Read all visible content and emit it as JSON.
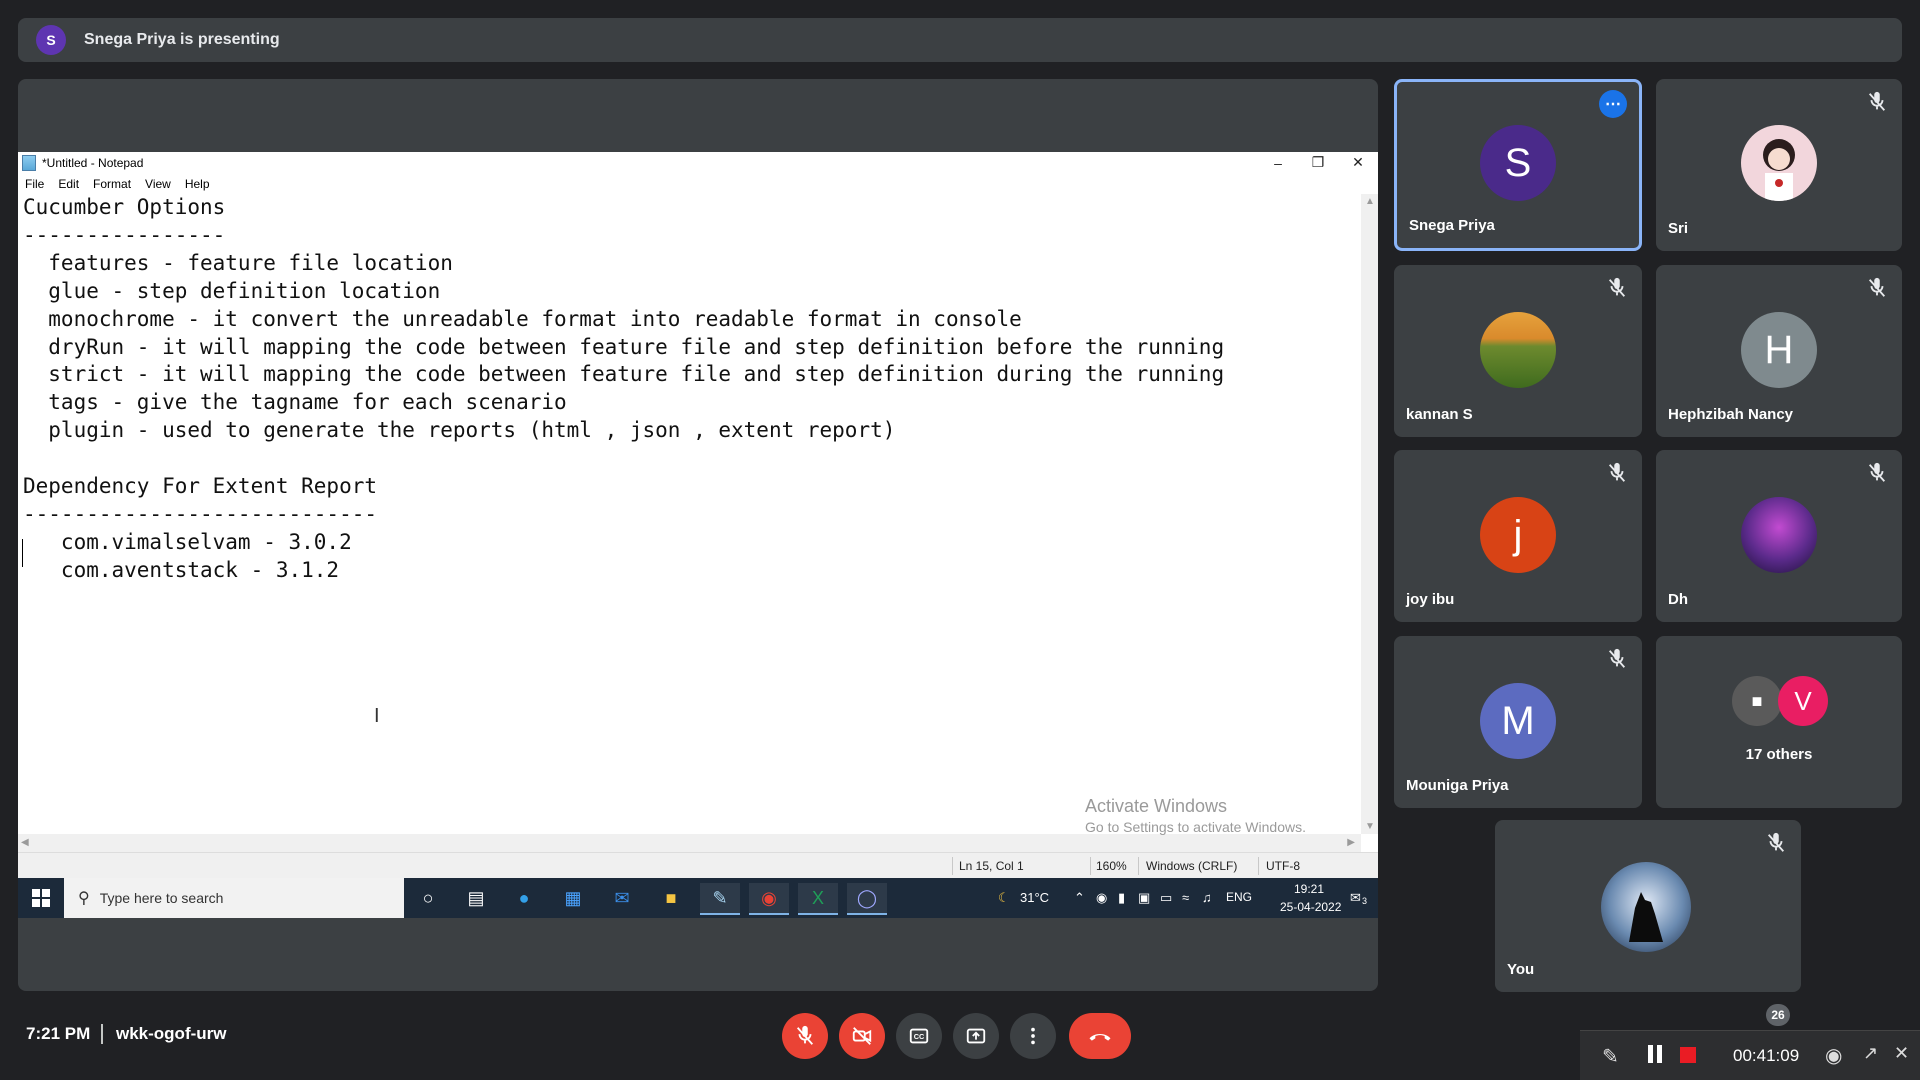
{
  "banner": {
    "avatar_letter": "S",
    "text": "Snega Priya is presenting"
  },
  "notepad": {
    "title": "*Untitled - Notepad",
    "menu": [
      "File",
      "Edit",
      "Format",
      "View",
      "Help"
    ],
    "content": "Cucumber Options\n----------------\n  features - feature file location\n  glue - step definition location\n  monochrome - it convert the unreadable format into readable format in console\n  dryRun - it will mapping the code between feature file and step definition before the running\n  strict - it will mapping the code between feature file and step definition during the running\n  tags - give the tagname for each scenario\n  plugin - used to generate the reports (html , json , extent report)\n\nDependency For Extent Report\n----------------------------\n   com.vimalselvam - 3.0.2\n   com.aventstack - 3.1.2",
    "status": {
      "position": "Ln 15, Col 1",
      "zoom": "160%",
      "line_ending": "Windows (CRLF)",
      "encoding": "UTF-8"
    },
    "watermark": {
      "line1": "Activate Windows",
      "line2": "Go to Settings to activate Windows."
    }
  },
  "taskbar": {
    "search_placeholder": "Type here to search",
    "weather": "31°C",
    "language": "ENG",
    "time": "19:21",
    "date": "25-04-2022",
    "notification_count": "3"
  },
  "participants": [
    {
      "name": "Snega Priya",
      "initial": "S",
      "color": "#4a2a8a",
      "active_speaker": true
    },
    {
      "name": "Sri",
      "initial": "",
      "color": "#f2d6dc",
      "muted": true
    },
    {
      "name": "kannan S",
      "initial": "",
      "color": "#6d8a2e",
      "muted": true
    },
    {
      "name": "Hephzibah Nancy",
      "initial": "H",
      "color": "#7f8a8e",
      "muted": true
    },
    {
      "name": "joy ibu",
      "initial": "j",
      "color": "#d84315",
      "muted": true
    },
    {
      "name": "Dh",
      "initial": "",
      "color": "#5a2a8a",
      "muted": true
    },
    {
      "name": "Mouniga Priya",
      "initial": "M",
      "color": "#5c6bc0",
      "muted": true
    },
    {
      "name": "You",
      "initial": "",
      "color": "#6a8ab0",
      "muted": true
    }
  ],
  "others": {
    "label": "17 others",
    "initial": "V",
    "color": "#e91e63"
  },
  "meeting": {
    "time": "7:21 PM",
    "code": "wkk-ogof-urw",
    "participant_badge": "26"
  },
  "recorder": {
    "elapsed": "00:41:09"
  }
}
